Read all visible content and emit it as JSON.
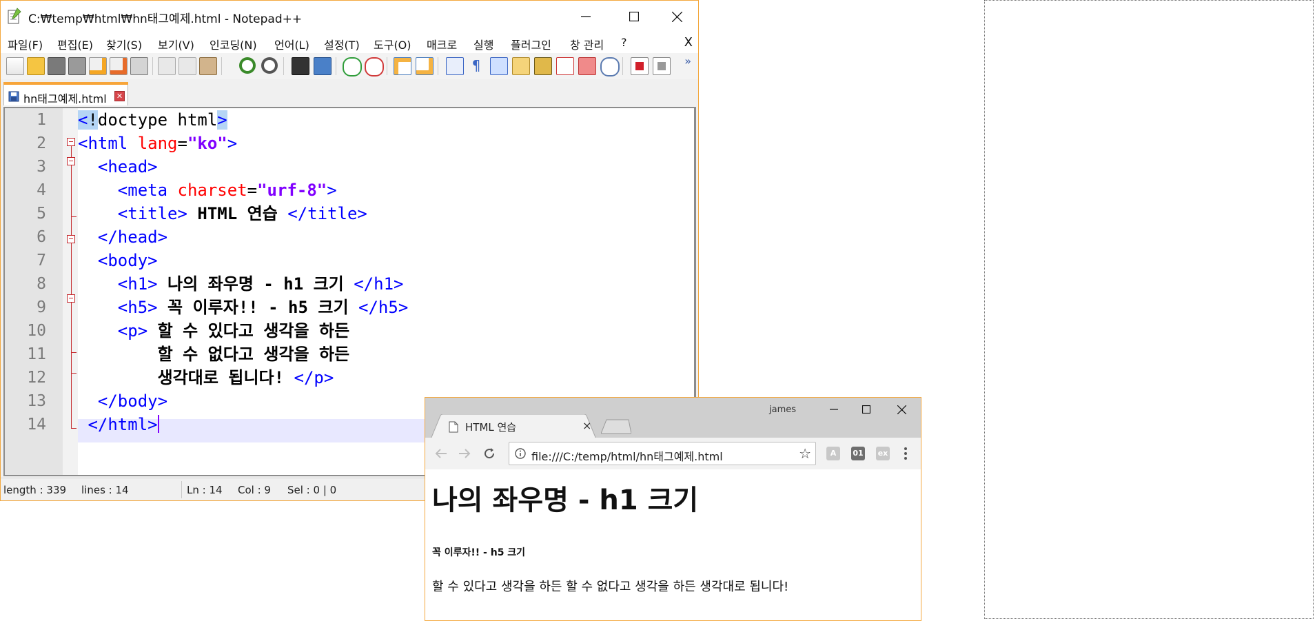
{
  "notepad": {
    "title": "C:₩temp₩html₩hn태그예제.html - Notepad++",
    "menu": [
      "파일(F)",
      "편집(E)",
      "찾기(S)",
      "보기(V)",
      "인코딩(N)",
      "언어(L)",
      "설정(T)",
      "도구(O)",
      "매크로",
      "실행",
      "플러그인",
      "창 관리",
      "?"
    ],
    "menu_close": "X",
    "toolbar_more": "»",
    "tab_label": "hn태그예제.html",
    "line_numbers": [
      "1",
      "2",
      "3",
      "4",
      "5",
      "6",
      "7",
      "8",
      "9",
      "10",
      "11",
      "12",
      "13",
      "14"
    ],
    "code": {
      "l1_lt": "<",
      "l1_bang": "!",
      "l1_mid": "doctype html",
      "l1_gt": ">",
      "l2_open": "<html ",
      "l2_attr": "lang",
      "l2_eq": "=",
      "l2_val": "\"ko\"",
      "l2_close": ">",
      "l3": "  <head>",
      "l4_open": "    <meta ",
      "l4_attr": "charset",
      "l4_eq": "=",
      "l4_val": "\"urf-8\"",
      "l4_close": ">",
      "l5_open": "    <title> ",
      "l5_text": "HTML 연습",
      "l5_close": " </title>",
      "l6": "  </head>",
      "l7": "  <body>",
      "l8_open": "    <h1> ",
      "l8_text": "나의 좌우명 - h1 크기",
      "l8_close": " </h1>",
      "l9_open": "    <h5> ",
      "l9_text": "꼭 이루자!! - h5 크기",
      "l9_close": " </h5>",
      "l10_open": "    <p> ",
      "l10_text": "할 수 있다고 생각을 하든",
      "l11_text": "        할 수 없다고 생각을 하든",
      "l12_text": "        생각대로 됩니다!",
      "l12_close": " </p>",
      "l13": "  </body>",
      "l14": " </html>"
    },
    "status": {
      "length": "length : 339",
      "lines": "lines : 14",
      "ln": "Ln : 14",
      "col": "Col : 9",
      "sel": "Sel : 0 | 0"
    }
  },
  "chrome": {
    "tab_title": "HTML 연습",
    "tab_close": "×",
    "user": "james",
    "url": "file:///C:/temp/html/hn태그예제.html",
    "star": "☆",
    "ext_acrobat": "A",
    "ext_binary": "01",
    "ext_gray": "ex",
    "page": {
      "h1": "나의 좌우명 - h1 크기",
      "h5": "꼭 이루자!! - h5 크기",
      "p": "할 수 있다고 생각을 하든 할 수 없다고 생각을 하든 생각대로 됩니다!"
    }
  },
  "icons": {
    "notepad_app": "notepad-icon",
    "minimize": "minimize-icon",
    "maximize": "maximize-icon",
    "close": "close-icon"
  },
  "colors": {
    "accent_orange": "#f3a73c",
    "tag_blue": "#0000ff",
    "attr_red": "#ff0000",
    "value_purple": "#8000ff",
    "fold_red": "#c4262b"
  }
}
